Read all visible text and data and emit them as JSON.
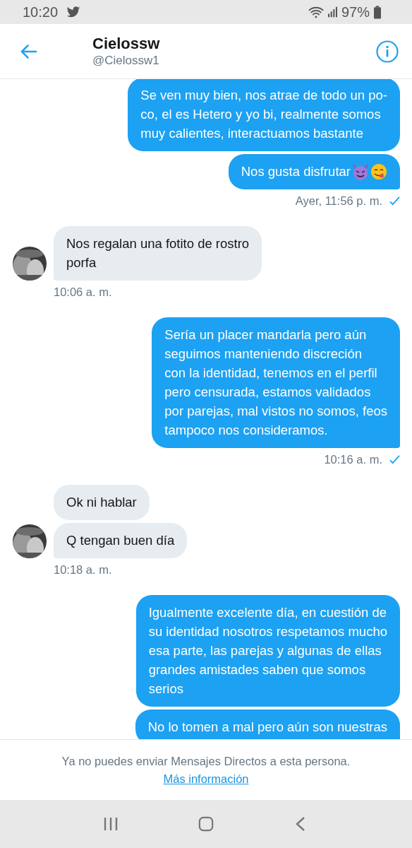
{
  "status_bar": {
    "time": "10:20",
    "battery": "97%"
  },
  "header": {
    "name": "Cielossw",
    "handle": "@Cielossw1"
  },
  "messages": [
    {
      "kind": "sent",
      "bubbles": [
        {
          "kind": "text",
          "text": "Se ven muy bien, nos atrae de todo un po-\nco, el es Hetero y yo bi, realmente somos\nmuy calientes, interactuamos bastante"
        },
        {
          "kind": "text_emoji",
          "text": "Nos gusta disfrutar"
        }
      ],
      "time": "Ayer, 11:56 p. m."
    },
    {
      "kind": "received",
      "bubbles": [
        {
          "kind": "text",
          "text": "Nos regalan una fotito de rostro\nporfa"
        }
      ],
      "time": "10:06 a. m."
    },
    {
      "kind": "sent",
      "bubbles": [
        {
          "kind": "text",
          "text": "Sería un placer mandarla pero aún\nseguimos manteniendo discreción\ncon la identidad, tenemos en el perfil\npero censurada, estamos validados\npor parejas, mal vistos no somos, feos\ntampoco nos consideramos."
        }
      ],
      "time": "10:16 a. m."
    },
    {
      "kind": "received",
      "bubbles": [
        {
          "kind": "text",
          "text": "Ok ni hablar"
        },
        {
          "kind": "text",
          "text": "Q tengan buen día"
        }
      ],
      "time": "10:18 a. m."
    },
    {
      "kind": "sent",
      "bubbles": [
        {
          "kind": "text",
          "text": "Igualmente excelente día, en cuestión de\nsu identidad nosotros respetamos mucho\nesa parte, las parejas y algunas de ellas\ngrandes amistades saben que somos\nserios"
        },
        {
          "kind": "text",
          "text": "No lo tomen a mal pero aún son nuestras"
        }
      ]
    }
  ],
  "footer": {
    "notice": "Ya no puedes enviar Mensajes Directos a esta persona.",
    "link": "Más información"
  }
}
